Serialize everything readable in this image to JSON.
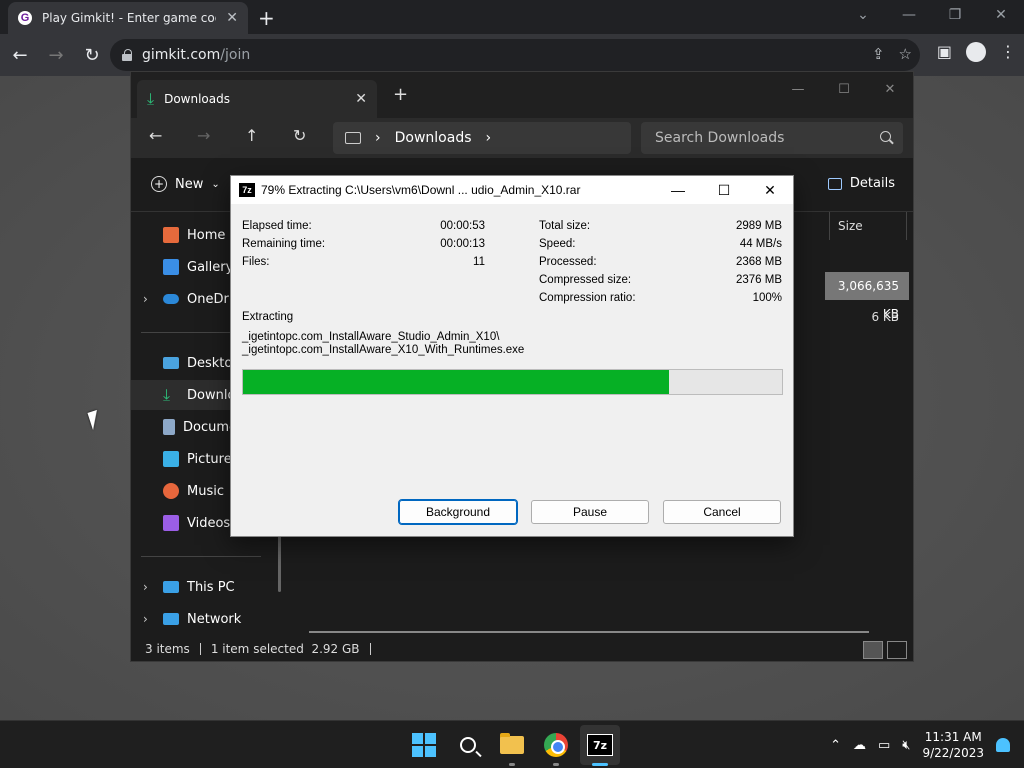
{
  "chrome": {
    "tab_title": "Play Gimkit! - Enter game code h",
    "tab_favicon": "G",
    "url_host": "gimkit.com",
    "url_path": "/join"
  },
  "explorer": {
    "tab_title": "Downloads",
    "breadcrumb": "Downloads",
    "search_placeholder": "Search Downloads",
    "new_label": "New",
    "details_label": "Details",
    "col_size": "Size",
    "rows": [
      {
        "size": "3,066,635 KB",
        "selected": true
      },
      {
        "size": "6 KB",
        "selected": false
      }
    ],
    "sidebar": [
      {
        "label": "Home",
        "color": "#e66a3c"
      },
      {
        "label": "Gallery",
        "color": "#3a8ee6"
      },
      {
        "label": "OneDrive",
        "color": "#2b88d8"
      },
      {
        "label": "Desktop",
        "color": "#4aa3df"
      },
      {
        "label": "Downloads",
        "color": "#2dbe7a"
      },
      {
        "label": "Documents",
        "color": "#8da8c8"
      },
      {
        "label": "Pictures",
        "color": "#3ab0e6"
      },
      {
        "label": "Music",
        "color": "#e6663c"
      },
      {
        "label": "Videos",
        "color": "#9b5ee6"
      },
      {
        "label": "This PC",
        "color": "#3aa0e6"
      },
      {
        "label": "Network",
        "color": "#3aa0e6"
      }
    ],
    "status": {
      "items": "3 items",
      "selected": "1 item selected  2.92 GB"
    }
  },
  "dialog": {
    "title": "79% Extracting C:\\Users\\vm6\\Downl ... udio_Admin_X10.rar",
    "icon_text": "7z",
    "progress_percent": 79,
    "stats_left": [
      {
        "label": "Elapsed time:",
        "value": "00:00:53"
      },
      {
        "label": "Remaining time:",
        "value": "00:00:13"
      },
      {
        "label": "Files:",
        "value": "11"
      }
    ],
    "stats_right": [
      {
        "label": "Total size:",
        "value": "2989 MB"
      },
      {
        "label": "Speed:",
        "value": "44 MB/s"
      },
      {
        "label": "Processed:",
        "value": "2368 MB"
      },
      {
        "label": "Compressed size:",
        "value": "2376 MB"
      },
      {
        "label": "Compression ratio:",
        "value": "100%"
      }
    ],
    "extracting_label": "Extracting",
    "path_line1": "_igetintopc.com_InstallAware_Studio_Admin_X10\\",
    "path_line2": "_igetintopc.com_InstallAware_X10_With_Runtimes.exe",
    "buttons": {
      "background": "Background",
      "pause": "Pause",
      "cancel": "Cancel"
    }
  },
  "taskbar": {
    "sevenzip_text": "7z",
    "time": "11:31 AM",
    "date": "9/22/2023"
  },
  "colors": {
    "progress": "#06b025",
    "accent": "#4cc2ff"
  }
}
